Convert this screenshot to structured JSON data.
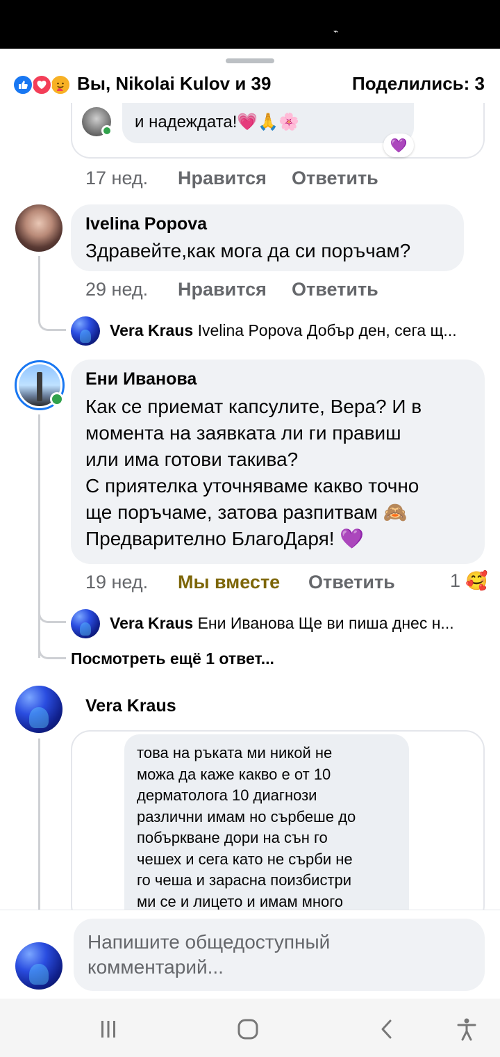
{
  "status_bar": {
    "mark": "⌁"
  },
  "header": {
    "reactors": "Вы, Nikolai Kulov и 39",
    "shares": "Поделились: 3",
    "reaction_icons": [
      "like-icon",
      "love-icon",
      "care-icon"
    ]
  },
  "comments": [
    {
      "text_fragment": "и надеждата!💗🙏🌸",
      "reaction": "💜",
      "time": "17 нед.",
      "like_label": "Нравится",
      "reply_label": "Ответить"
    },
    {
      "author": "Ivelina Popova",
      "text": "Здравейте,как мога да си поръчам?",
      "time": "29 нед.",
      "like_label": "Нравится",
      "reply_label": "Ответить",
      "reply_preview": {
        "author": "Vera Kraus",
        "text": "Ivelina Popova Добър ден, сега щ..."
      }
    },
    {
      "author": "Ени Иванова",
      "text_lines": [
        "Как се приемат капсулите, Вера? И в",
        "момента на заявката ли ги правиш",
        "или има готови такива?",
        "С приятелка уточняваме какво точно",
        "ще поръчаме, затова разпитвам 🙈",
        "Предварително БлагоДаря! 💜"
      ],
      "time": "19 нед.",
      "like_label": "Мы вместе",
      "reply_label": "Ответить",
      "reaction_count": "1",
      "reaction_emoji": "🥰",
      "reply_preview": {
        "author": "Vera Kraus",
        "text": "Ени Иванова Ще ви пиша днес н..."
      },
      "more_replies": "Посмотреть ещё 1 ответ..."
    },
    {
      "author": "Vera Kraus",
      "image_text_lines": [
        "това на ръката ми никой не",
        "можа да каже какво е от 10",
        "дерматолога 10 диагнози",
        "различни имам но сърбеше до",
        "побъркване дори на сън го",
        "чешех и сега като не сърби не",
        "го чеша и зарасна поизбистри",
        "ми се и лицето и имам много"
      ]
    }
  ],
  "composer": {
    "placeholder_lines": [
      "Напишите общедоступный",
      "комментарий..."
    ]
  },
  "nav": {
    "icons": [
      "recents-icon",
      "home-icon",
      "back-icon",
      "accessibility-icon"
    ]
  }
}
